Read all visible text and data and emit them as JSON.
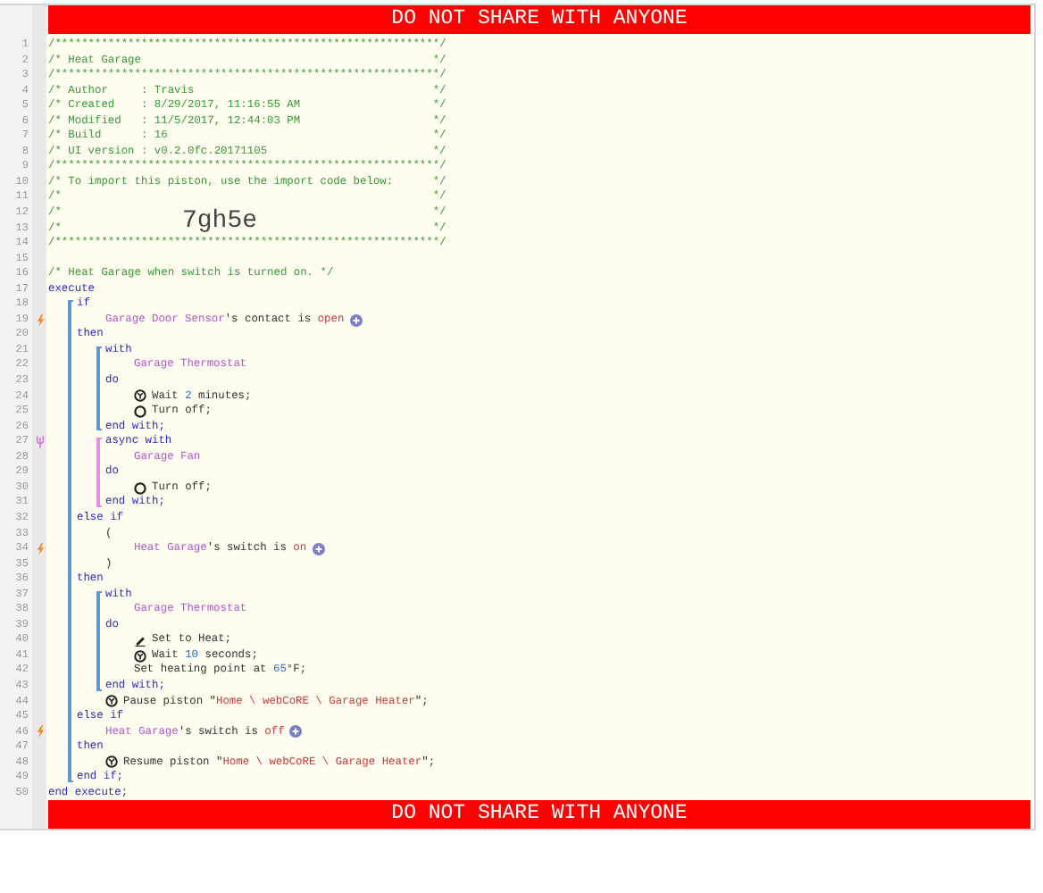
{
  "top_banner": "DO NOT SHARE WITH ANYONE",
  "code": [
    {
      "kind": "comment",
      "number": "1",
      "text": "/**********************************************************/"
    },
    {
      "kind": "comment",
      "number": "2",
      "text": "/* Heat Garage",
      "end": "*/"
    },
    {
      "kind": "comment",
      "number": "3",
      "text": "/**********************************************************/"
    },
    {
      "kind": "comment",
      "number": "4",
      "text": "/* Author     : Travis",
      "end": "*/"
    },
    {
      "kind": "comment",
      "number": "5",
      "text": "/* Created    : 8/29/2017, 11:16:55 AM",
      "end": "*/"
    },
    {
      "kind": "comment",
      "number": "6",
      "text": "/* Modified   : 11/5/2017, 12:44:03 PM",
      "end": "*/"
    },
    {
      "kind": "comment",
      "number": "7",
      "text": "/* Build      : 16",
      "end": "*/"
    },
    {
      "kind": "comment",
      "number": "8",
      "text": "/* UI version : v0.2.0fc.20171105",
      "end": "*/"
    },
    {
      "kind": "comment",
      "number": "9",
      "text": "/**********************************************************/"
    },
    {
      "kind": "comment",
      "number": "10",
      "text": "/* To import this piston, use the import code below:",
      "end": "*/"
    },
    {
      "kind": "comment",
      "number": "11",
      "text": "/*",
      "end": "*/"
    },
    {
      "kind": "comment",
      "number": "12",
      "text": "/*",
      "end": "*/"
    },
    {
      "kind": "comment",
      "number": "13",
      "text": "/*",
      "overlay": "7gh5e",
      "end": "*/"
    },
    {
      "kind": "comment",
      "number": "14",
      "text": "/**********************************************************/"
    },
    {
      "kind": "line",
      "number": "15"
    },
    {
      "kind": "comment",
      "number": "16",
      "text": "/* Heat Garage when switch is turned on. */"
    },
    {
      "kind": "line",
      "number": "17",
      "segments": [
        {
          "kind": "keyword",
          "text": "execute"
        }
      ],
      "children": [
        {
          "kind": "block",
          "color": "#5b9bd5",
          "children": [
            {
              "kind": "line",
              "number": "18",
              "segments": [
                {
                  "kind": "keyword",
                  "text": "if"
                }
              ],
              "children": [
                {
                  "kind": "line",
                  "number": "19",
                  "marker": {
                    "kind": "trigger"
                  },
                  "segments": [
                    {
                      "kind": "device",
                      "text": "Garage Door Sensor"
                    },
                    {
                      "kind": "plain",
                      "text": "'s contact is "
                    },
                    {
                      "kind": "value",
                      "text": "open"
                    },
                    {
                      "kind": "icon-add"
                    }
                  ]
                }
              ]
            },
            {
              "kind": "line",
              "number": "20",
              "segments": [
                {
                  "kind": "keyword",
                  "text": "then"
                }
              ],
              "children": [
                {
                  "kind": "block",
                  "color": "#5b9bd5",
                  "children": [
                    {
                      "kind": "line",
                      "number": "21",
                      "segments": [
                        {
                          "kind": "keyword",
                          "text": "with"
                        }
                      ],
                      "children": [
                        {
                          "kind": "line",
                          "number": "22",
                          "segments": [
                            {
                              "kind": "device",
                              "text": "Garage Thermostat"
                            }
                          ]
                        }
                      ]
                    },
                    {
                      "kind": "line",
                      "number": "23",
                      "segments": [
                        {
                          "kind": "keyword",
                          "text": "do"
                        }
                      ],
                      "children": [
                        {
                          "kind": "line",
                          "number": "24",
                          "segments": [
                            {
                              "kind": "icon-timer"
                            },
                            {
                              "kind": "plain",
                              "text": "Wait "
                            },
                            {
                              "kind": "number",
                              "text": "2"
                            },
                            {
                              "kind": "plain",
                              "text": " minutes;"
                            }
                          ]
                        },
                        {
                          "kind": "line",
                          "number": "25",
                          "segments": [
                            {
                              "kind": "icon-power"
                            },
                            {
                              "kind": "plain",
                              "text": "Turn off;"
                            }
                          ]
                        }
                      ]
                    },
                    {
                      "kind": "line",
                      "number": "26",
                      "segments": [
                        {
                          "kind": "keyword",
                          "text": "end with;"
                        }
                      ]
                    }
                  ]
                },
                {
                  "kind": "block",
                  "color": "#e78fe3",
                  "children": [
                    {
                      "kind": "line",
                      "number": "27",
                      "marker": {
                        "kind": "async"
                      },
                      "segments": [
                        {
                          "kind": "keyword",
                          "text": "async with"
                        }
                      ],
                      "children": [
                        {
                          "kind": "line",
                          "number": "28",
                          "segments": [
                            {
                              "kind": "device",
                              "text": "Garage Fan"
                            }
                          ]
                        }
                      ]
                    },
                    {
                      "kind": "line",
                      "number": "29",
                      "segments": [
                        {
                          "kind": "keyword",
                          "text": "do"
                        }
                      ],
                      "children": [
                        {
                          "kind": "line",
                          "number": "30",
                          "segments": [
                            {
                              "kind": "icon-power"
                            },
                            {
                              "kind": "plain",
                              "text": "Turn off;"
                            }
                          ]
                        }
                      ]
                    },
                    {
                      "kind": "line",
                      "number": "31",
                      "segments": [
                        {
                          "kind": "keyword",
                          "text": "end with;"
                        }
                      ]
                    }
                  ]
                }
              ]
            },
            {
              "kind": "line",
              "number": "32",
              "segments": [
                {
                  "kind": "keyword",
                  "text": "else if"
                }
              ],
              "children": [
                {
                  "kind": "line",
                  "number": "33",
                  "segments": [
                    {
                      "kind": "plain",
                      "text": "("
                    }
                  ],
                  "children": [
                    {
                      "kind": "line",
                      "number": "34",
                      "marker": {
                        "kind": "trigger"
                      },
                      "segments": [
                        {
                          "kind": "device",
                          "text": "Heat Garage"
                        },
                        {
                          "kind": "plain",
                          "text": "'s switch is "
                        },
                        {
                          "kind": "value",
                          "text": "on"
                        },
                        {
                          "kind": "icon-add"
                        }
                      ]
                    }
                  ]
                },
                {
                  "kind": "line",
                  "number": "35",
                  "segments": [
                    {
                      "kind": "plain",
                      "text": ")"
                    }
                  ]
                }
              ]
            },
            {
              "kind": "line",
              "number": "36",
              "segments": [
                {
                  "kind": "keyword",
                  "text": "then"
                }
              ],
              "children": [
                {
                  "kind": "block",
                  "color": "#5b9bd5",
                  "children": [
                    {
                      "kind": "line",
                      "number": "37",
                      "segments": [
                        {
                          "kind": "keyword",
                          "text": "with"
                        }
                      ],
                      "children": [
                        {
                          "kind": "line",
                          "number": "38",
                          "segments": [
                            {
                              "kind": "device",
                              "text": "Garage Thermostat"
                            }
                          ]
                        }
                      ]
                    },
                    {
                      "kind": "line",
                      "number": "39",
                      "segments": [
                        {
                          "kind": "keyword",
                          "text": "do"
                        }
                      ],
                      "children": [
                        {
                          "kind": "line",
                          "number": "40",
                          "segments": [
                            {
                              "kind": "icon-edit"
                            },
                            {
                              "kind": "plain",
                              "text": "Set to Heat;"
                            }
                          ]
                        },
                        {
                          "kind": "line",
                          "number": "41",
                          "segments": [
                            {
                              "kind": "icon-timer"
                            },
                            {
                              "kind": "plain",
                              "text": "Wait "
                            },
                            {
                              "kind": "number",
                              "text": "10"
                            },
                            {
                              "kind": "plain",
                              "text": " seconds;"
                            }
                          ]
                        },
                        {
                          "kind": "line",
                          "number": "42",
                          "segments": [
                            {
                              "kind": "plain",
                              "text": "Set heating point at "
                            },
                            {
                              "kind": "number",
                              "text": "65"
                            },
                            {
                              "kind": "plain",
                              "text": "°F;"
                            }
                          ]
                        }
                      ]
                    },
                    {
                      "kind": "line",
                      "number": "43",
                      "segments": [
                        {
                          "kind": "keyword",
                          "text": "end with;"
                        }
                      ]
                    }
                  ]
                },
                {
                  "kind": "line",
                  "number": "44",
                  "segments": [
                    {
                      "kind": "icon-timer"
                    },
                    {
                      "kind": "plain",
                      "text": "Pause piston \""
                    },
                    {
                      "kind": "string",
                      "text": "Home \\ webCoRE \\ Garage Heater"
                    },
                    {
                      "kind": "plain",
                      "text": "\";"
                    }
                  ]
                }
              ]
            },
            {
              "kind": "line",
              "number": "45",
              "segments": [
                {
                  "kind": "keyword",
                  "text": "else if"
                }
              ],
              "children": [
                {
                  "kind": "line",
                  "number": "46",
                  "marker": {
                    "kind": "trigger"
                  },
                  "segments": [
                    {
                      "kind": "device",
                      "text": "Heat Garage"
                    },
                    {
                      "kind": "plain",
                      "text": "'s switch is "
                    },
                    {
                      "kind": "value",
                      "text": "off"
                    },
                    {
                      "kind": "icon-add"
                    }
                  ]
                }
              ]
            },
            {
              "kind": "line",
              "number": "47",
              "segments": [
                {
                  "kind": "keyword",
                  "text": "then"
                }
              ],
              "children": [
                {
                  "kind": "line",
                  "number": "48",
                  "segments": [
                    {
                      "kind": "icon-timer"
                    },
                    {
                      "kind": "plain",
                      "text": "Resume piston \""
                    },
                    {
                      "kind": "string",
                      "text": "Home \\ webCoRE \\ Garage Heater"
                    },
                    {
                      "kind": "plain",
                      "text": "\";"
                    }
                  ]
                }
              ]
            },
            {
              "kind": "line",
              "number": "49",
              "segments": [
                {
                  "kind": "keyword",
                  "text": "end if;"
                }
              ]
            }
          ]
        }
      ]
    },
    {
      "kind": "line",
      "number": "50",
      "segments": [
        {
          "kind": "keyword",
          "text": "end execute;"
        }
      ]
    }
  ],
  "bottom_banner": "DO NOT SHARE WITH ANYONE"
}
